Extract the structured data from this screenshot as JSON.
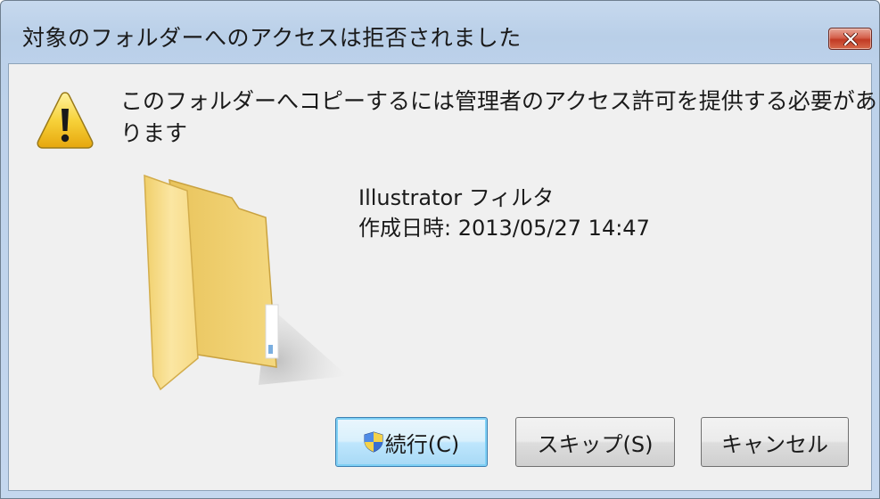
{
  "window": {
    "title": "対象のフォルダーへのアクセスは拒否されました"
  },
  "message": {
    "line1": "このフォルダーへコピーするには管理者のアクセス許可を提供する必要があ",
    "line2": "ります"
  },
  "item": {
    "name": "Illustrator フィルタ",
    "created": "作成日時: 2013/05/27 14:47"
  },
  "buttons": {
    "continue_label": "続行(C)",
    "skip_label": "スキップ(S)",
    "cancel_label": "キャンセル"
  },
  "icons": {
    "warning": "warning-triangle-icon",
    "folder": "folder-icon",
    "shield": "uac-shield-icon",
    "close": "close-icon"
  },
  "colors": {
    "titlebar": "#bcd1ea",
    "client_bg": "#f0f0f0",
    "close_button": "#c13a24",
    "default_button": "#bee6fd"
  }
}
